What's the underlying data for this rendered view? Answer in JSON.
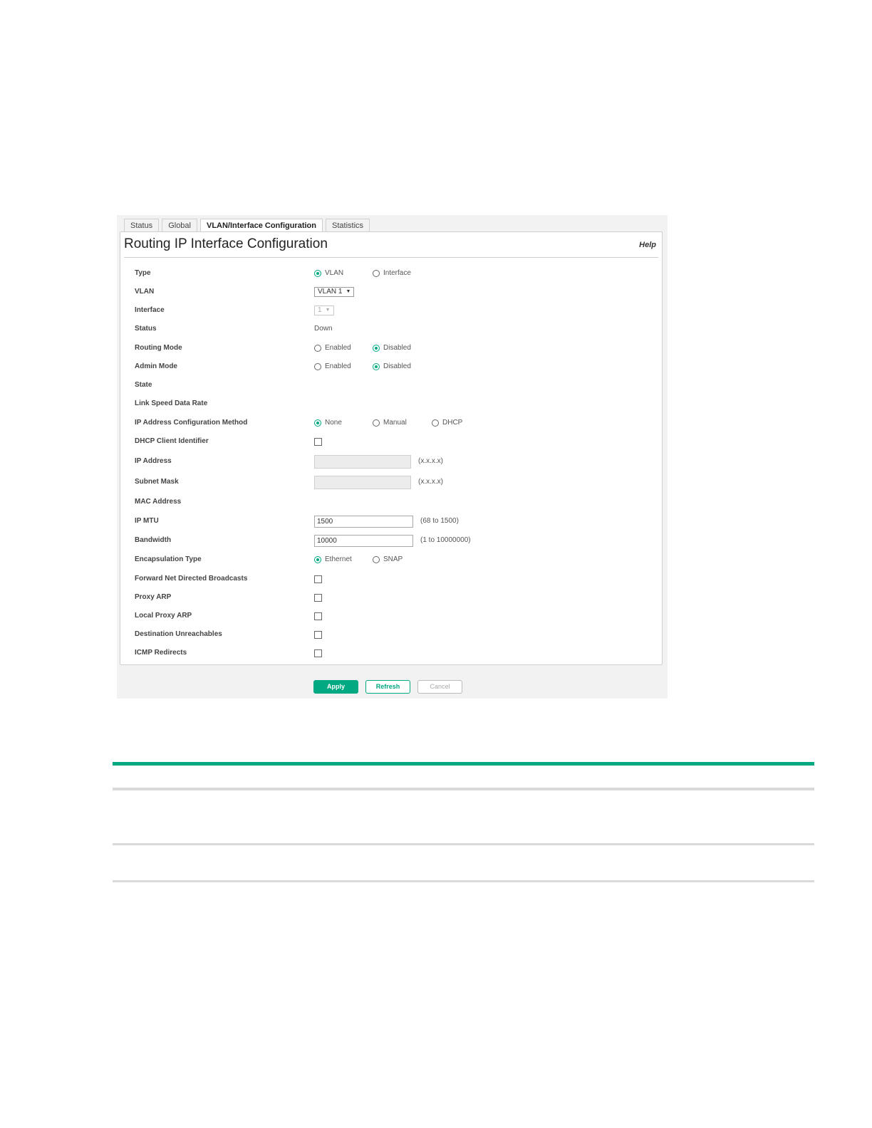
{
  "tabs": [
    "Status",
    "Global",
    "VLAN/Interface Configuration",
    "Statistics"
  ],
  "active_tab": "VLAN/Interface Configuration",
  "page_title": "Routing IP Interface Configuration",
  "help_label": "Help",
  "form": {
    "type": {
      "label": "Type",
      "options": [
        "VLAN",
        "Interface"
      ],
      "selected": "VLAN"
    },
    "vlan": {
      "label": "VLAN",
      "value": "VLAN 1"
    },
    "interface": {
      "label": "Interface",
      "value": "1"
    },
    "status": {
      "label": "Status",
      "value": "Down"
    },
    "routing_mode": {
      "label": "Routing Mode",
      "options": [
        "Enabled",
        "Disabled"
      ],
      "selected": "Disabled"
    },
    "admin_mode": {
      "label": "Admin Mode",
      "options": [
        "Enabled",
        "Disabled"
      ],
      "selected": "Disabled"
    },
    "state": {
      "label": "State"
    },
    "link_speed": {
      "label": "Link Speed Data Rate"
    },
    "ip_config_method": {
      "label": "IP Address Configuration Method",
      "options": [
        "None",
        "Manual",
        "DHCP"
      ],
      "selected": "None"
    },
    "dhcp_client_id": {
      "label": "DHCP Client Identifier",
      "checked": false
    },
    "ip_address": {
      "label": "IP Address",
      "value": "",
      "hint": "(x.x.x.x)"
    },
    "subnet_mask": {
      "label": "Subnet Mask",
      "value": "",
      "hint": "(x.x.x.x)"
    },
    "mac_address": {
      "label": "MAC Address"
    },
    "ip_mtu": {
      "label": "IP MTU",
      "value": "1500",
      "hint": "(68 to 1500)"
    },
    "bandwidth": {
      "label": "Bandwidth",
      "value": "10000",
      "hint": "(1 to 10000000)"
    },
    "encapsulation": {
      "label": "Encapsulation Type",
      "options": [
        "Ethernet",
        "SNAP"
      ],
      "selected": "Ethernet"
    },
    "fwd_net_directed": {
      "label": "Forward Net Directed Broadcasts",
      "checked": false
    },
    "proxy_arp": {
      "label": "Proxy ARP",
      "checked": false
    },
    "local_proxy_arp": {
      "label": "Local Proxy ARP",
      "checked": false
    },
    "dest_unreachables": {
      "label": "Destination Unreachables",
      "checked": false
    },
    "icmp_redirects": {
      "label": "ICMP Redirects",
      "checked": false
    }
  },
  "buttons": {
    "apply": "Apply",
    "refresh": "Refresh",
    "cancel": "Cancel"
  },
  "colors": {
    "accent": "#01a982",
    "rule_gray": "#d9d9d9"
  }
}
